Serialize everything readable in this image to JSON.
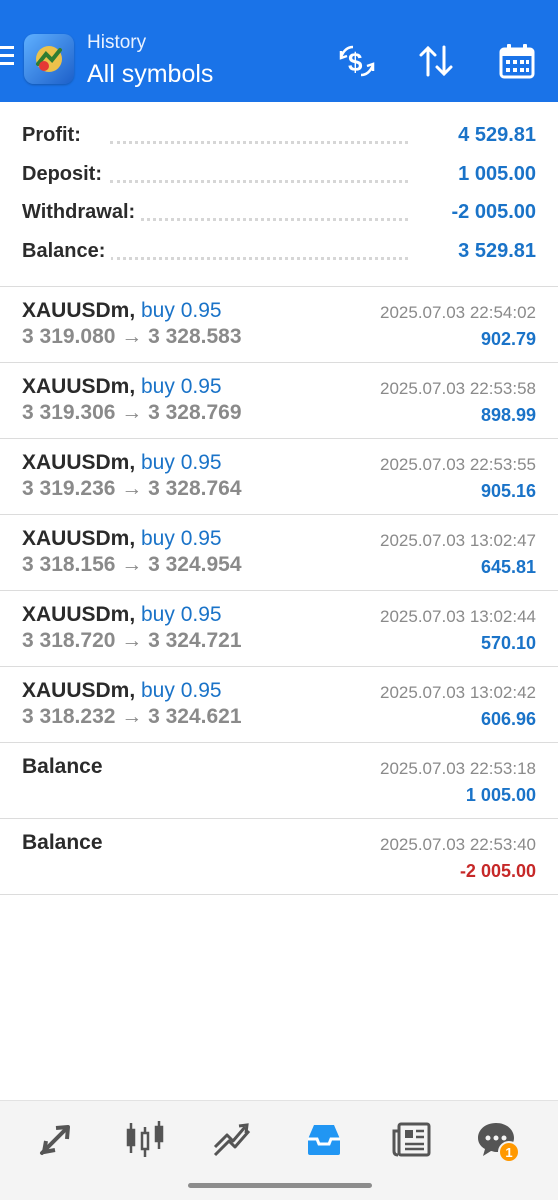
{
  "header": {
    "subtitle": "History",
    "title": "All symbols",
    "background": "#1a73e8"
  },
  "summary": {
    "profit_label": "Profit:",
    "profit_value": "4 529.81",
    "deposit_label": "Deposit:",
    "deposit_value": "1 005.00",
    "withdrawal_label": "Withdrawal:",
    "withdrawal_value": "-2 005.00",
    "balance_label": "Balance:",
    "balance_value": "3 529.81"
  },
  "deals": [
    {
      "symbol": "XAUUSDm,",
      "type": "buy 0.95",
      "prices": "3 319.080 → 3 328.583",
      "time": "2025.07.03 22:54:02",
      "profit": "902.79"
    },
    {
      "symbol": "XAUUSDm,",
      "type": "buy 0.95",
      "prices": "3 319.306 → 3 328.769",
      "time": "2025.07.03 22:53:58",
      "profit": "898.99"
    },
    {
      "symbol": "XAUUSDm,",
      "type": "buy 0.95",
      "prices": "3 319.236 → 3 328.764",
      "time": "2025.07.03 22:53:55",
      "profit": "905.16"
    },
    {
      "symbol": "XAUUSDm,",
      "type": "buy 0.95",
      "prices": "3 318.156 → 3 324.954",
      "time": "2025.07.03 13:02:47",
      "profit": "645.81"
    },
    {
      "symbol": "XAUUSDm,",
      "type": "buy 0.95",
      "prices": "3 318.720 → 3 324.721",
      "time": "2025.07.03 13:02:44",
      "profit": "570.10"
    },
    {
      "symbol": "XAUUSDm,",
      "type": "buy 0.95",
      "prices": "3 318.232 → 3 324.621",
      "time": "2025.07.03 13:02:42",
      "profit": "606.96"
    }
  ],
  "balance_ops": [
    {
      "label": "Balance",
      "time": "2025.07.03 22:53:18",
      "amount": "1 005.00"
    },
    {
      "label": "Balance",
      "time": "2025.07.03 22:53:40",
      "amount": "-2 005.00"
    }
  ],
  "bottom_nav": {
    "items": [
      "quotes-icon",
      "chart-icon",
      "trade-icon",
      "history-icon",
      "news-icon",
      "chat-icon"
    ],
    "active": "history-icon",
    "chat_badge": "1"
  },
  "colors": {
    "accent": "#1a73c8",
    "negative": "#c62828",
    "badge": "#ff9800"
  }
}
